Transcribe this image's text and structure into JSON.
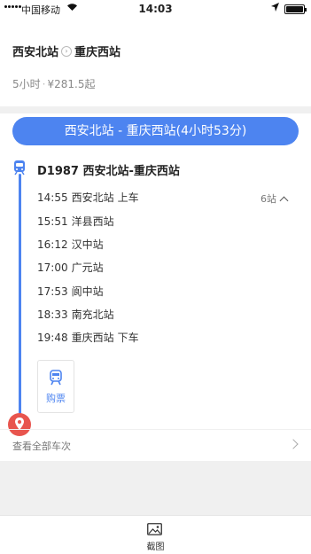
{
  "status_bar": {
    "carrier": "中国移动",
    "wifi_icon": "wifi-icon",
    "time": "14:03",
    "location_icon": "location-arrow-icon",
    "battery_icon": "battery-icon"
  },
  "header": {
    "from_station": "西安北站",
    "to_station": "重庆西站",
    "arrow_icon": "chevron-right-circle-icon",
    "duration": "5小时",
    "separator": "·",
    "price": "¥281.5起"
  },
  "route": {
    "title": "西安北站 - 重庆西站(4小时53分)",
    "train": "D1987 西安北站-重庆西站",
    "stops_count": "6站",
    "stops": [
      {
        "time": "14:55",
        "station": "西安北站",
        "action": "上车"
      },
      {
        "time": "15:51",
        "station": "洋县西站",
        "action": ""
      },
      {
        "time": "16:12",
        "station": "汉中站",
        "action": ""
      },
      {
        "time": "17:00",
        "station": "广元站",
        "action": ""
      },
      {
        "time": "17:53",
        "station": "阆中站",
        "action": ""
      },
      {
        "time": "18:33",
        "station": "南充北站",
        "action": ""
      },
      {
        "time": "19:48",
        "station": "重庆西站",
        "action": "下车"
      }
    ],
    "buy_label": "购票",
    "view_all": "查看全部车次"
  },
  "bottom": {
    "screenshot_label": "截图"
  },
  "colors": {
    "accent": "#4d84f0",
    "pin": "#e8554e"
  }
}
